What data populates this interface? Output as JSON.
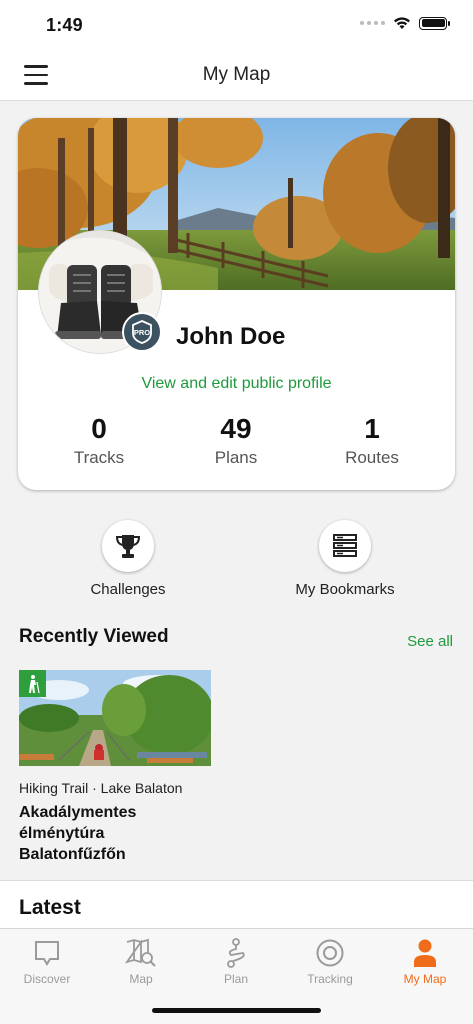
{
  "status_bar": {
    "time": "1:49"
  },
  "nav": {
    "title": "My Map"
  },
  "profile": {
    "name": "John Doe",
    "badge": "PRO",
    "link": "View and edit public profile",
    "stats": [
      {
        "value": "0",
        "label": "Tracks"
      },
      {
        "value": "49",
        "label": "Plans"
      },
      {
        "value": "1",
        "label": "Routes"
      }
    ]
  },
  "quick_actions": [
    {
      "label": "Challenges",
      "icon": "trophy-icon"
    },
    {
      "label": "My Bookmarks",
      "icon": "bookmarks-icon"
    }
  ],
  "recently_viewed": {
    "title": "Recently Viewed",
    "see_all": "See all",
    "items": [
      {
        "meta": "Hiking Trail · Lake Balaton",
        "title": "Akadálymentes élménytúra Balatonfűzfőn",
        "icon": "hiking-icon"
      }
    ]
  },
  "latest": {
    "title": "Latest"
  },
  "tabs": [
    {
      "label": "Discover",
      "icon": "discover-icon"
    },
    {
      "label": "Map",
      "icon": "map-icon"
    },
    {
      "label": "Plan",
      "icon": "plan-icon"
    },
    {
      "label": "Tracking",
      "icon": "tracking-icon"
    },
    {
      "label": "My Map",
      "icon": "my-map-icon",
      "active": true
    }
  ],
  "colors": {
    "accent_green": "#1e9a3c",
    "active_tab": "#ef6c1a",
    "badge_bg": "#3d5260"
  }
}
